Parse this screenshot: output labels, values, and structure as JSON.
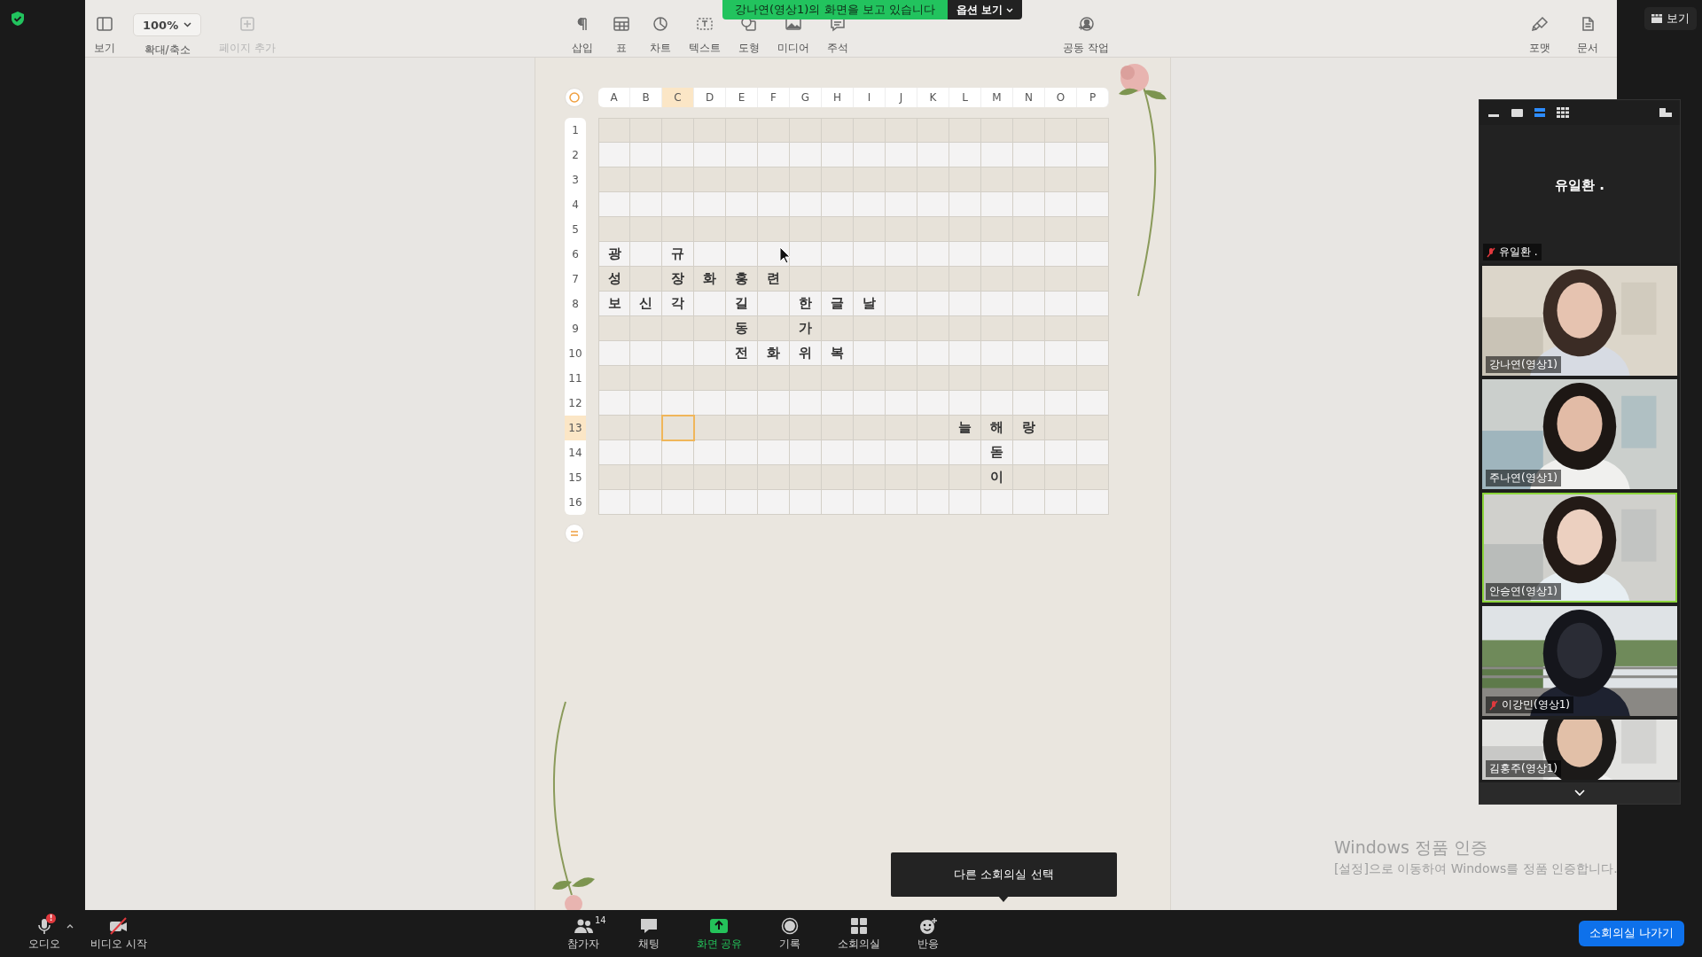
{
  "share_banner": {
    "text": "강나연(영상1)의 화면을 보고 있습니다",
    "options_button": "옵션 보기"
  },
  "corner_view_button": "보기",
  "toolbar": {
    "left": [
      {
        "label": "보기",
        "kind": "sidebar",
        "disabled": false
      },
      {
        "label": "확대/축소",
        "kind": "zoom",
        "value": "100%",
        "disabled": false
      },
      {
        "label": "페이지 추가",
        "kind": "add",
        "disabled": true
      }
    ],
    "center": [
      {
        "label": "삽입",
        "kind": "pilcrow"
      },
      {
        "label": "표",
        "kind": "table"
      },
      {
        "label": "차트",
        "kind": "chart"
      },
      {
        "label": "텍스트",
        "kind": "text"
      },
      {
        "label": "도형",
        "kind": "shape"
      },
      {
        "label": "미디어",
        "kind": "media"
      },
      {
        "label": "주석",
        "kind": "comment"
      }
    ],
    "collaborate": {
      "label": "공동 작업",
      "kind": "collab"
    },
    "right": [
      {
        "label": "포맷",
        "kind": "brush"
      },
      {
        "label": "문서",
        "kind": "document"
      }
    ]
  },
  "spreadsheet": {
    "columns": [
      {
        "label": "A",
        "selected": false
      },
      {
        "label": "B",
        "selected": false
      },
      {
        "label": "C",
        "selected": true
      },
      {
        "label": "D",
        "selected": false
      },
      {
        "label": "E",
        "selected": false
      },
      {
        "label": "F",
        "selected": false
      },
      {
        "label": "G",
        "selected": false
      },
      {
        "label": "H",
        "selected": false
      },
      {
        "label": "I",
        "selected": false
      },
      {
        "label": "J",
        "selected": false
      },
      {
        "label": "K",
        "selected": false
      },
      {
        "label": "L",
        "selected": false
      },
      {
        "label": "M",
        "selected": false
      },
      {
        "label": "N",
        "selected": false
      },
      {
        "label": "O",
        "selected": false
      },
      {
        "label": "P",
        "selected": false
      }
    ],
    "rows": [
      {
        "number": "1",
        "selected": false,
        "cells": [
          null,
          null,
          null,
          null,
          null,
          null,
          null,
          null,
          null,
          null,
          null,
          null,
          null,
          null,
          null,
          null
        ]
      },
      {
        "number": "2",
        "selected": false,
        "cells": [
          null,
          null,
          null,
          null,
          null,
          null,
          null,
          null,
          null,
          null,
          null,
          null,
          null,
          null,
          null,
          null
        ]
      },
      {
        "number": "3",
        "selected": false,
        "cells": [
          null,
          null,
          null,
          null,
          null,
          null,
          null,
          null,
          null,
          null,
          null,
          null,
          null,
          null,
          null,
          null
        ]
      },
      {
        "number": "4",
        "selected": false,
        "cells": [
          null,
          null,
          null,
          null,
          null,
          null,
          null,
          null,
          null,
          null,
          null,
          null,
          null,
          null,
          null,
          null
        ]
      },
      {
        "number": "5",
        "selected": false,
        "cells": [
          null,
          null,
          null,
          null,
          null,
          null,
          null,
          null,
          null,
          null,
          null,
          null,
          null,
          null,
          null,
          null
        ]
      },
      {
        "number": "6",
        "selected": false,
        "cells": [
          "광",
          null,
          "규",
          null,
          null,
          null,
          null,
          null,
          null,
          null,
          null,
          null,
          null,
          null,
          null,
          null
        ]
      },
      {
        "number": "7",
        "selected": false,
        "cells": [
          "성",
          null,
          "장",
          "화",
          "홍",
          "련",
          null,
          null,
          null,
          null,
          null,
          null,
          null,
          null,
          null,
          null
        ]
      },
      {
        "number": "8",
        "selected": false,
        "cells": [
          "보",
          "신",
          "각",
          null,
          "길",
          null,
          "한",
          "글",
          "날",
          null,
          null,
          null,
          null,
          null,
          null,
          null
        ]
      },
      {
        "number": "9",
        "selected": false,
        "cells": [
          null,
          null,
          null,
          null,
          "동",
          null,
          "가",
          null,
          null,
          null,
          null,
          null,
          null,
          null,
          null,
          null
        ]
      },
      {
        "number": "10",
        "selected": false,
        "cells": [
          null,
          null,
          null,
          null,
          "전",
          "화",
          "위",
          "복",
          null,
          null,
          null,
          null,
          null,
          null,
          null,
          null
        ]
      },
      {
        "number": "11",
        "selected": false,
        "cells": [
          null,
          null,
          null,
          null,
          null,
          null,
          null,
          null,
          null,
          null,
          null,
          null,
          null,
          null,
          null,
          null
        ]
      },
      {
        "number": "12",
        "selected": false,
        "cells": [
          null,
          null,
          null,
          null,
          null,
          null,
          null,
          null,
          null,
          null,
          null,
          null,
          null,
          null,
          null,
          null
        ]
      },
      {
        "number": "13",
        "selected": true,
        "cells": [
          null,
          null,
          null,
          null,
          null,
          null,
          null,
          null,
          null,
          null,
          null,
          "늘",
          "해",
          "랑",
          null,
          null
        ]
      },
      {
        "number": "14",
        "selected": false,
        "cells": [
          null,
          null,
          null,
          null,
          null,
          null,
          null,
          null,
          null,
          null,
          null,
          null,
          "돋",
          null,
          null,
          null
        ]
      },
      {
        "number": "15",
        "selected": false,
        "cells": [
          null,
          null,
          null,
          null,
          null,
          null,
          null,
          null,
          null,
          null,
          null,
          null,
          "이",
          null,
          null,
          null
        ]
      },
      {
        "number": "16",
        "selected": false,
        "cells": [
          null,
          null,
          null,
          null,
          null,
          null,
          null,
          null,
          null,
          null,
          null,
          null,
          null,
          null,
          null,
          null
        ]
      }
    ]
  },
  "participants_panel": {
    "speaker": {
      "name": "유일환 .",
      "label": "유일환 .",
      "muted": true
    },
    "tiles": [
      {
        "name": "강나연(영상1)",
        "muted": false,
        "active_speaker": false,
        "kind": "picture"
      },
      {
        "name": "주나연(영상1)",
        "muted": false,
        "active_speaker": false,
        "kind": "picture"
      },
      {
        "name": "안승연(영상1)",
        "muted": false,
        "active_speaker": true,
        "kind": "picture"
      },
      {
        "name": "이강민(영상1)",
        "muted": true,
        "active_speaker": false,
        "kind": "picture"
      },
      {
        "name": "김홍주(영상1)",
        "muted": false,
        "active_speaker": false,
        "kind": "picture"
      }
    ]
  },
  "windows_notice": {
    "title": "Windows 정품 인증",
    "message": "[설정]으로 이동하여 Windows를 정품 인증합니다."
  },
  "tooltip": "다른 소회의실 선택",
  "bottom_bar": {
    "left": [
      {
        "label": "오디오",
        "kind": "audio",
        "alert": "!"
      },
      {
        "label": "비디오 시작",
        "kind": "video-off"
      }
    ],
    "center": [
      {
        "label": "참가자",
        "kind": "participants",
        "count": "14",
        "highlighted": false
      },
      {
        "label": "채팅",
        "kind": "chat",
        "highlighted": false
      },
      {
        "label": "화면 공유",
        "kind": "share",
        "highlighted": true
      },
      {
        "label": "기록",
        "kind": "record",
        "highlighted": false
      },
      {
        "label": "소회의실",
        "kind": "rooms",
        "highlighted": false
      },
      {
        "label": "반응",
        "kind": "reaction",
        "highlighted": false
      }
    ],
    "leave_button": "소회의실 나가기"
  }
}
